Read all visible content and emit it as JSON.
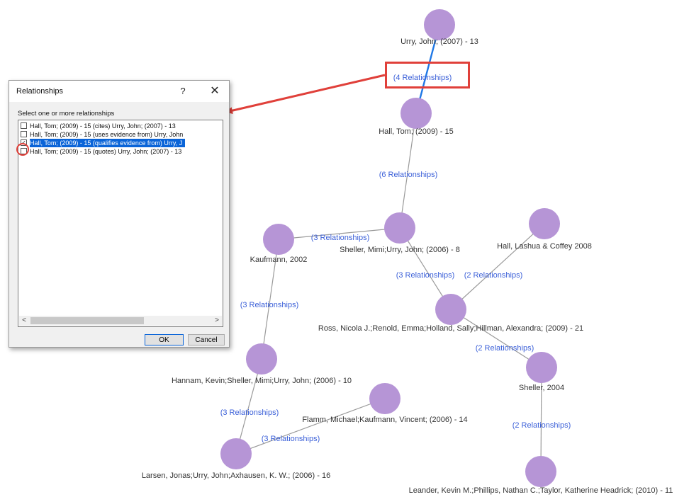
{
  "graph": {
    "nodes": [
      {
        "id": "urry2007",
        "label": "Urry, John; (2007) - 13"
      },
      {
        "id": "hall2009",
        "label": "Hall, Tom; (2009) - 15"
      },
      {
        "id": "sheller2006",
        "label": "Sheller, Mimi;Urry, John; (2006) - 8"
      },
      {
        "id": "kaufmann2002",
        "label": "Kaufmann, 2002"
      },
      {
        "id": "hall2008",
        "label": "Hall, Lashua & Coffey 2008"
      },
      {
        "id": "ross2009",
        "label": "Ross, Nicola J.;Renold, Emma;Holland, Sally;Hillman, Alexandra; (2009) - 21"
      },
      {
        "id": "hannam2006",
        "label": "Hannam, Kevin;Sheller, Mimi;Urry, John; (2006) - 10"
      },
      {
        "id": "sheller2004",
        "label": "Sheller, 2004"
      },
      {
        "id": "flamm2006",
        "label": "Flamm, Michael;Kaufmann, Vincent; (2006) - 14"
      },
      {
        "id": "larsen2006",
        "label": "Larsen, Jonas;Urry, John;Axhausen, K. W.; (2006) - 16"
      },
      {
        "id": "leander2010",
        "label": "Leander, Kevin M.;Phillips, Nathan C.;Taylor, Katherine Headrick; (2010) - 11"
      }
    ],
    "edges": [
      {
        "from": "urry2007",
        "to": "hall2009",
        "label": "(4 Relationships)",
        "selected": true
      },
      {
        "from": "hall2009",
        "to": "sheller2006",
        "label": "(6 Relationships)"
      },
      {
        "from": "kaufmann2002",
        "to": "sheller2006",
        "label": "(3 Relationships)"
      },
      {
        "from": "sheller2006",
        "to": "ross2009",
        "label": "(3 Relationships)"
      },
      {
        "from": "hall2008",
        "to": "ross2009",
        "label": "(2 Relationships)"
      },
      {
        "from": "kaufmann2002",
        "to": "hannam2006",
        "label": "(3 Relationships)"
      },
      {
        "from": "ross2009",
        "to": "sheller2004",
        "label": "(2 Relationships)"
      },
      {
        "from": "hannam2006",
        "to": "larsen2006",
        "label": "(3 Relationships)"
      },
      {
        "from": "larsen2006",
        "to": "flamm2006",
        "label": "(3 Relationships)"
      },
      {
        "from": "sheller2004",
        "to": "leander2010",
        "label": "(2 Relationships)"
      }
    ]
  },
  "dialog": {
    "title": "Relationships",
    "help_glyph": "?",
    "close_glyph": "✕",
    "prompt": "Select one or more relationships",
    "items": [
      {
        "text": "Hall, Tom; (2009) - 15 (cites) Urry, John; (2007) - 13",
        "checked": false,
        "selected": false
      },
      {
        "text": "Hall, Tom; (2009) - 15 (uses evidence from) Urry, John",
        "checked": false,
        "selected": false
      },
      {
        "text": "Hall, Tom; (2009) - 15 (qualifies evidence from) Urry, J",
        "checked": true,
        "selected": true
      },
      {
        "text": "Hall, Tom; (2009) - 15 (quotes) Urry, John; (2007) - 13",
        "checked": false,
        "selected": false
      }
    ],
    "scroll_left": "<",
    "scroll_right": ">",
    "ok_label": "OK",
    "cancel_label": "Cancel"
  },
  "colors": {
    "node": "#b695d6",
    "edge": "#9a9a9a",
    "selected_edge": "#1f78e6",
    "edge_label": "#3a5fd8",
    "callout": "#e0403a",
    "selection": "#0a64d8"
  }
}
